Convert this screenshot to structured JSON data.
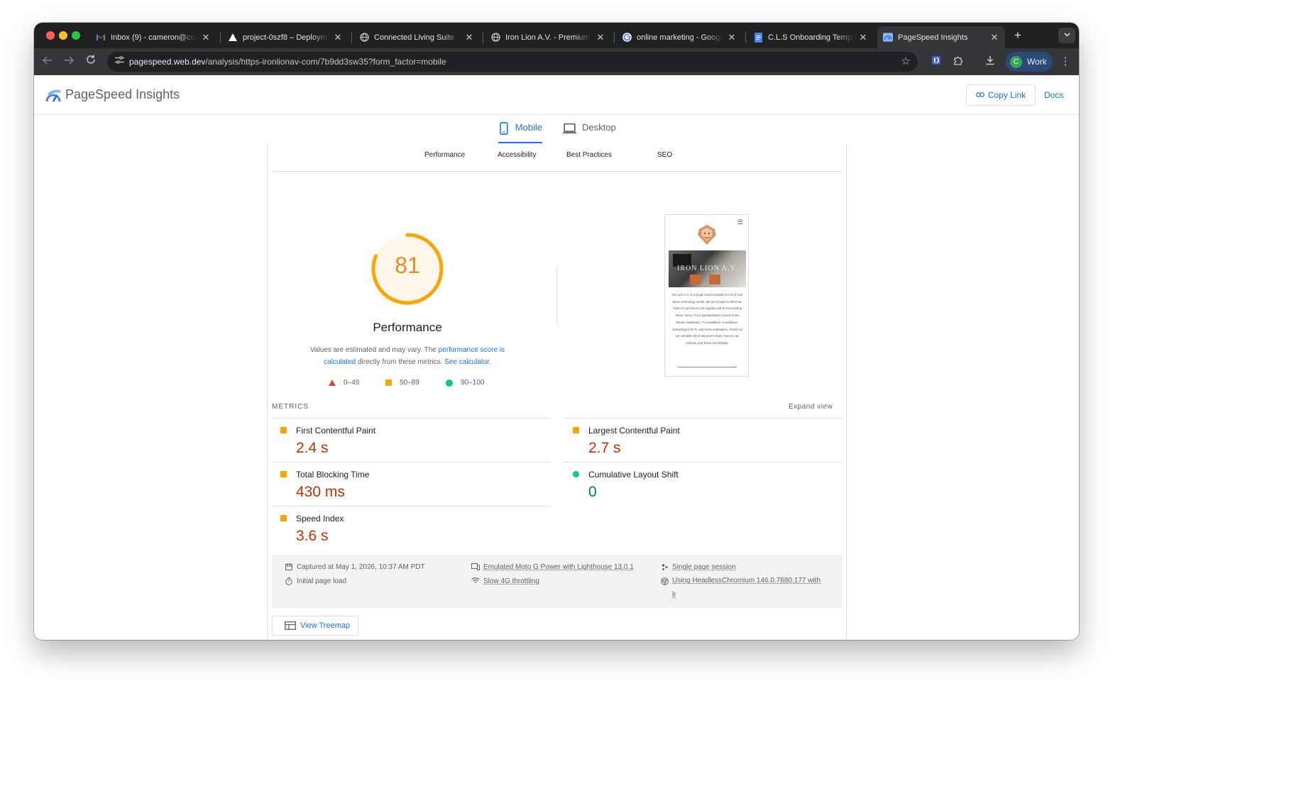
{
  "browser": {
    "tabs": [
      {
        "title": "Inbox (9) - cameron@con",
        "icon": "gmail-icon",
        "active": false
      },
      {
        "title": "project-0szf8 – Deployme",
        "icon": "vercel-icon",
        "active": false
      },
      {
        "title": "Connected Living Suite - I",
        "icon": "globe-icon",
        "active": false
      },
      {
        "title": "Iron Lion A.V. - Premium A",
        "icon": "globe-icon",
        "active": false
      },
      {
        "title": "online marketing - Google",
        "icon": "google-icon",
        "active": false
      },
      {
        "title": "C.L.S Onboarding Templa",
        "icon": "docs-icon",
        "active": false
      },
      {
        "title": "PageSpeed Insights",
        "icon": "pagespeed-icon",
        "active": true
      }
    ],
    "url_host": "pagespeed.web.dev",
    "url_path": "/analysis/https-ironlionav-com/7b9dd3sw35?form_factor=mobile",
    "profile_initial": "C",
    "profile_name": "Work"
  },
  "header": {
    "title": "PageSpeed Insights",
    "copy_link": "Copy Link",
    "docs": "Docs"
  },
  "device_tabs": {
    "mobile": "Mobile",
    "desktop": "Desktop"
  },
  "categories": [
    "Performance",
    "Accessibility",
    "Best Practices",
    "SEO"
  ],
  "score": {
    "value": "81",
    "fraction": 0.81,
    "label": "Performance",
    "note_prefix": "Values are estimated and may vary. The ",
    "note_link1": "performance score is calculated",
    "note_mid": " directly from these metrics. ",
    "note_link2": "See calculator."
  },
  "legend": [
    {
      "range": "0–49",
      "shape": "triangle",
      "color": "#e8453c"
    },
    {
      "range": "50–89",
      "shape": "square",
      "color": "#ffa400"
    },
    {
      "range": "90–100",
      "shape": "circle",
      "color": "#0cce6b"
    }
  ],
  "screenshot": {
    "brand": "IRON LION A.V.",
    "body": "Iron Lion A.V. is a single source provider for all of your home technology needs. We are located in Sherman Oaks CA and serve Los Angeles and its surrounding areas. Some of our specializations include home theater installation, TV installation, surveillance, networking & Wi-Fi, and home automation. Check out our complete list of services to learn how we can improve your home and lifestyle."
  },
  "metrics_section": {
    "label": "METRICS",
    "expand": "Expand view",
    "items": [
      {
        "name": "First Contentful Paint",
        "value": "2.4 s",
        "status": "average",
        "indicator_color": "#ffa400",
        "value_color": "#c33300"
      },
      {
        "name": "Largest Contentful Paint",
        "value": "2.7 s",
        "status": "average",
        "indicator_color": "#ffa400",
        "value_color": "#c33300"
      },
      {
        "name": "Total Blocking Time",
        "value": "430 ms",
        "status": "average",
        "indicator_color": "#ffa400",
        "value_color": "#c33300"
      },
      {
        "name": "Cumulative Layout Shift",
        "value": "0",
        "status": "pass",
        "indicator_color": "#0cce6b",
        "value_color": "#018642"
      },
      {
        "name": "Speed Index",
        "value": "3.6 s",
        "status": "average",
        "indicator_color": "#ffa400",
        "value_color": "#c33300"
      }
    ]
  },
  "run_info": {
    "captured": "Captured at May 1, 2026, 10:37 AM PDT",
    "initial_load": "Initial page load",
    "emulated": "Emulated Moto G Power with Lighthouse 13.0.1",
    "throttling": "Slow 4G throttling",
    "session": "Single page session",
    "using_line1": "Using HeadlessChromium 146.0.7680.177 with",
    "using_line2": "lr"
  },
  "treemap": "View Treemap"
}
